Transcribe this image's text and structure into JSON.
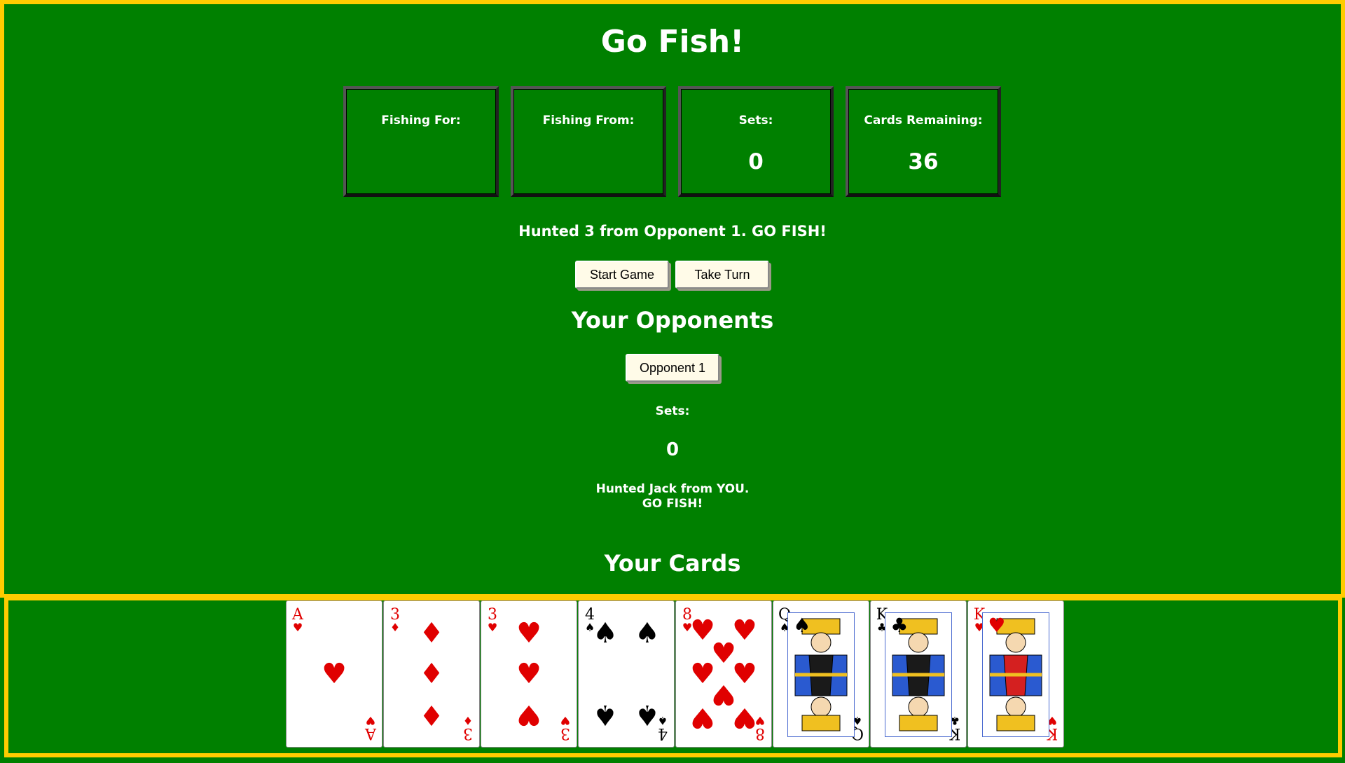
{
  "title": "Go Fish!",
  "stats": {
    "fishing_for_label": "Fishing For:",
    "fishing_for_value": "",
    "fishing_from_label": "Fishing From:",
    "fishing_from_value": "",
    "sets_label": "Sets:",
    "sets_value": "0",
    "cards_remaining_label": "Cards Remaining:",
    "cards_remaining_value": "36"
  },
  "status_message": "Hunted 3 from Opponent 1. GO FISH!",
  "buttons": {
    "start_game": "Start Game",
    "take_turn": "Take Turn"
  },
  "opponents": {
    "heading": "Your Opponents",
    "list": [
      {
        "name": "Opponent 1",
        "sets_label": "Sets:",
        "sets_value": "0",
        "message_line1": "Hunted Jack from YOU.",
        "message_line2": "GO FISH!"
      }
    ]
  },
  "hand": {
    "heading": "Your Cards",
    "cards": [
      {
        "rank": "A",
        "suit": "hearts"
      },
      {
        "rank": "3",
        "suit": "diamonds"
      },
      {
        "rank": "3",
        "suit": "hearts"
      },
      {
        "rank": "4",
        "suit": "spades"
      },
      {
        "rank": "8",
        "suit": "hearts"
      },
      {
        "rank": "Q",
        "suit": "spades"
      },
      {
        "rank": "K",
        "suit": "clubs"
      },
      {
        "rank": "K",
        "suit": "hearts"
      }
    ]
  },
  "colors": {
    "table_green": "#008000",
    "frame_yellow": "#ffcc00",
    "button_cream": "#fffbe8",
    "red_suit": "#e00000"
  }
}
